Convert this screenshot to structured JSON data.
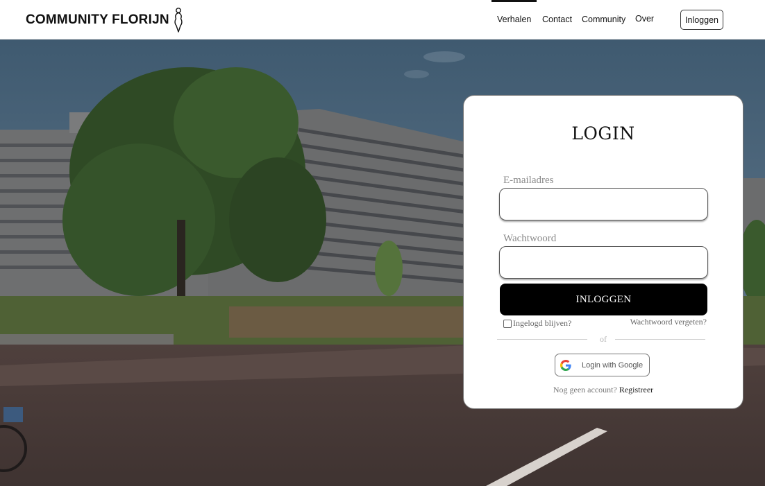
{
  "header": {
    "logo_text": "COMMUNITY FLORIJN",
    "nav": [
      {
        "label": "Verhalen",
        "active": true
      },
      {
        "label": "Contact",
        "active": false
      },
      {
        "label": "Community",
        "active": false
      },
      {
        "label": "Over",
        "active": false
      }
    ],
    "login_button": "Inloggen"
  },
  "login": {
    "title": "LOGIN",
    "email_label": "E-mailadres",
    "email_value": "",
    "password_label": "Wachtwoord",
    "password_value": "",
    "submit_label": "INLOGGEN",
    "remember_label": "Ingelogd blijven?",
    "remember_checked": false,
    "forgot_label": "Wachtwoord vergeten?",
    "divider_text": "of",
    "google_label": "Login with Google",
    "no_account_text": "Nog geen account?",
    "register_label": "Registreer"
  },
  "icons": {
    "logo": "woman-silhouette-icon",
    "google": "google-g-icon"
  },
  "colors": {
    "primary_button": "#000000",
    "card_background": "#ffffff"
  }
}
